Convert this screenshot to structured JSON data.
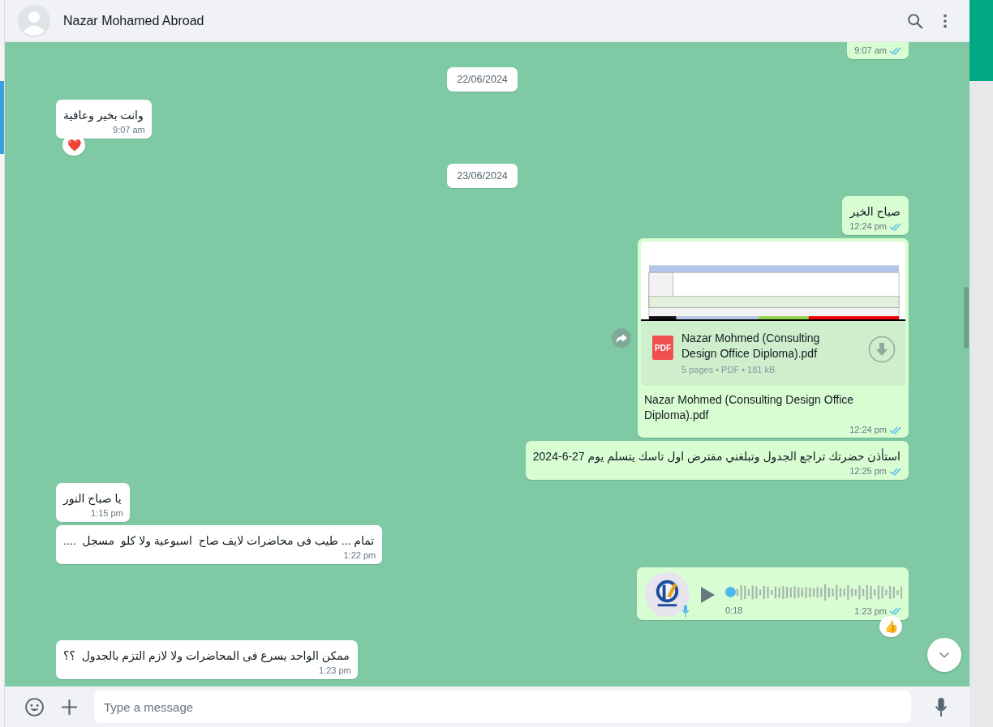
{
  "header": {
    "name": "Nazar Mohamed Abroad"
  },
  "messages": [
    {
      "kind": "text",
      "outgoing": true,
      "time": "9:07 am",
      "read": true
    },
    {
      "kind": "date",
      "text": "22/06/2024"
    },
    {
      "kind": "text",
      "outgoing": false,
      "text": "وانت بخير وعافية",
      "time": "9:07 am",
      "reaction": "❤️"
    },
    {
      "kind": "date",
      "text": "23/06/2024"
    },
    {
      "kind": "text",
      "outgoing": true,
      "text": "صباح الخير",
      "time": "12:24 pm",
      "read": true
    },
    {
      "kind": "document",
      "outgoing": true,
      "file_type": "PDF",
      "file_name": "Nazar Mohmed (Consulting Design Office Diploma).pdf",
      "meta": "5 pages • PDF • 181 kB",
      "caption": "Nazar Mohmed (Consulting Design Office Diploma).pdf",
      "time": "12:24 pm",
      "read": true
    },
    {
      "kind": "text",
      "outgoing": true,
      "text": "استأذن حضرتك تراجع الجدول وتبلغني مفترض اول تاسك يتسلم يوم 27-6-2024",
      "time": "12:25 pm",
      "read": true
    },
    {
      "kind": "text",
      "outgoing": false,
      "text": "يا صباح النور",
      "time": "1:15 pm"
    },
    {
      "kind": "text",
      "outgoing": false,
      "text": "تمام ... طيب فى محاضرات لايف صاح  اسبوعية ولا كلو  مسجل  ....",
      "time": "1:22 pm"
    },
    {
      "kind": "voice",
      "outgoing": true,
      "duration": "0:18",
      "level": 0,
      "time": "1:23 pm",
      "read": true,
      "reaction": "👍"
    },
    {
      "kind": "text",
      "outgoing": false,
      "text": "ممكن الواحد يسرع فى المحاضرات ولا لازم التزم بالجدول  ؟؟",
      "time": "1:23 pm"
    }
  ],
  "composer": {
    "placeholder": "Type a message"
  }
}
